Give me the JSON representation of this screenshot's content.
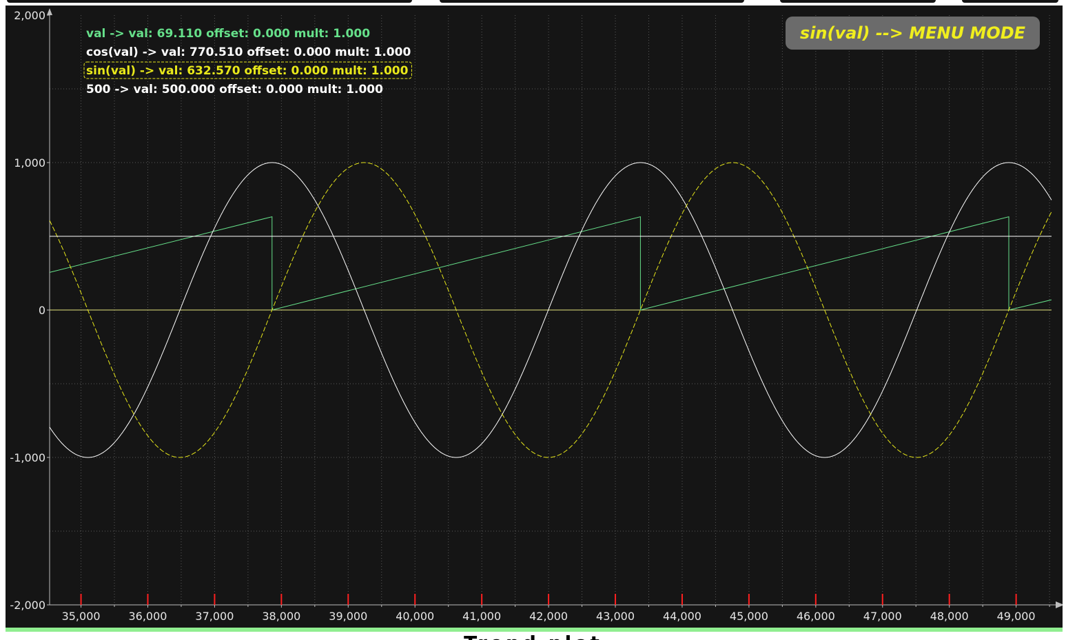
{
  "window": {
    "footer_title": "Trend plot",
    "mode_badge": "sin(val) --> MENU MODE"
  },
  "colors": {
    "background": "#151515",
    "grid": "#5a5a5a",
    "axis": "#bdbdbd",
    "tick_marker": "#ff2020",
    "badge_bg": "#6b6b6b",
    "badge_text": "#f0ee1e",
    "status_strip": "#90ee90"
  },
  "chart_data": {
    "type": "line",
    "title": "",
    "xlabel": "",
    "ylabel": "",
    "xlim": [
      34530,
      49530
    ],
    "ylim": [
      -2000,
      2000
    ],
    "x_ticks": [
      35000,
      36000,
      37000,
      38000,
      39000,
      40000,
      41000,
      42000,
      43000,
      44000,
      45000,
      46000,
      47000,
      48000,
      49000
    ],
    "x_tick_labels": [
      "35,000",
      "36,000",
      "37,000",
      "38,000",
      "39,000",
      "40,000",
      "41,000",
      "42,000",
      "43,000",
      "44,000",
      "45,000",
      "46,000",
      "47,000",
      "48,000",
      "49,000"
    ],
    "y_ticks": [
      -2000,
      -1000,
      0,
      1000,
      2000
    ],
    "y_tick_labels": [
      "-2,000",
      "-1,000",
      "0",
      "1,000",
      "2,000"
    ],
    "grid": true,
    "legend_position": "top-left",
    "series": [
      {
        "name": "val",
        "legend": "val ->  val: 69.110 offset: 0.000 mult: 1.000",
        "color": "#66e08a",
        "style": "solid",
        "kind": "sawtooth",
        "period": 5515,
        "reset_x": [
          37860,
          43375,
          48890
        ],
        "peak": 632.57,
        "current": 69.11,
        "x": [
          34530,
          37860,
          37860,
          43375,
          43375,
          48890,
          48890,
          49530
        ],
        "values": [
          255,
          632.57,
          0,
          632.57,
          0,
          632.57,
          0,
          69.11
        ]
      },
      {
        "name": "cos(val)",
        "legend": "cos(val) ->  val: 770.510 offset: 0.000 mult: 1.000",
        "color": "#ffffff",
        "style": "solid",
        "kind": "cosine",
        "amplitude": 1000,
        "period": 5515,
        "phase_x": 37860,
        "current": 770.51
      },
      {
        "name": "sin(val)",
        "legend": "sin(val) ->  val: 632.570 offset: 0.000 mult: 1.000",
        "color": "#e8e81a",
        "style": "dashed",
        "highlighted": true,
        "kind": "sine",
        "amplitude": 1000,
        "period": 5515,
        "phase_x": 37860,
        "current": 632.57
      },
      {
        "name": "500",
        "legend": "500 ->  val: 500.000 offset: 0.000 mult: 1.000",
        "color": "#ffffff",
        "style": "solid",
        "kind": "constant",
        "values": [
          500
        ]
      }
    ],
    "reference_lines": [
      {
        "y": 0,
        "color": "#e8e880"
      }
    ]
  }
}
